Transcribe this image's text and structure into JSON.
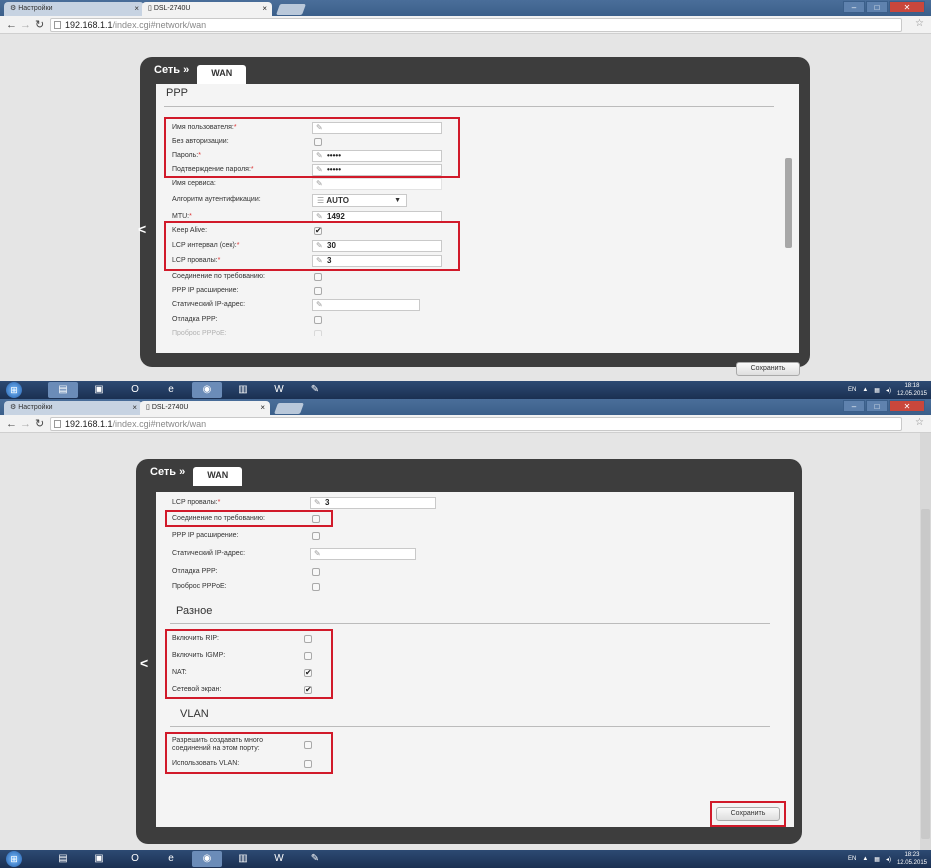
{
  "browser": {
    "tabs": [
      {
        "label": "Настройки",
        "icon": "gear-icon"
      },
      {
        "label": "DSL-2740U",
        "icon": "page-icon"
      }
    ],
    "url_host": "192.168.1.1",
    "url_path": "/index.cgi#network/wan"
  },
  "panel": {
    "breadcrumb": "Сеть »",
    "tab": "WAN",
    "save_label": "Сохранить"
  },
  "shot1": {
    "section_title": "PPP",
    "fields": {
      "username": {
        "label": "Имя пользователя:",
        "value": ""
      },
      "no_auth": {
        "label": "Без авторизации:"
      },
      "password": {
        "label": "Пароль:",
        "value": "•••••"
      },
      "password_confirm": {
        "label": "Подтверждение пароля:",
        "value": "•••••"
      },
      "service_name": {
        "label": "Имя сервиса:",
        "value": ""
      },
      "auth_algorithm": {
        "label": "Алгоритм аутентификации:",
        "value": "AUTO"
      },
      "mtu": {
        "label": "MTU:",
        "value": "1492"
      },
      "keep_alive": {
        "label": "Keep Alive:",
        "checked": true
      },
      "lcp_interval": {
        "label": "LCP интервал (сек):",
        "value": "30"
      },
      "lcp_fails": {
        "label": "LCP провалы:",
        "value": "3"
      },
      "on_demand": {
        "label": "Соединение по требованию:"
      },
      "ppp_ip_ext": {
        "label": "PPP IP расширение:"
      },
      "static_ip": {
        "label": "Статический IP-адрес:",
        "value": ""
      },
      "ppp_debug": {
        "label": "Отладка PPP:"
      },
      "pppoe_pass": {
        "label": "Проброс PPPoE:"
      }
    }
  },
  "shot2": {
    "fields": {
      "lcp_fails": {
        "label": "LCP провалы:",
        "value": "3"
      },
      "on_demand": {
        "label": "Соединение по требованию:"
      },
      "ppp_ip_ext": {
        "label": "PPP IP расширение:"
      },
      "static_ip": {
        "label": "Статический IP-адрес:",
        "value": ""
      },
      "ppp_debug": {
        "label": "Отладка PPP:"
      },
      "pppoe_pass": {
        "label": "Проброс PPPoE:"
      }
    },
    "misc_title": "Разное",
    "misc": {
      "rip": {
        "label": "Включить RIP:",
        "checked": false
      },
      "igmp": {
        "label": "Включить IGMP:",
        "checked": false
      },
      "nat": {
        "label": "NAT:",
        "checked": true
      },
      "firewall": {
        "label": "Сетевой экран:",
        "checked": true
      }
    },
    "vlan_title": "VLAN",
    "vlan": {
      "multi_conn_line1": "Разрешить создавать много",
      "multi_conn_line2": "соединений на этом порту:",
      "use_vlan": {
        "label": "Использовать VLAN:"
      }
    }
  },
  "taskbar": {
    "lang": "EN",
    "shot1_time": "18:18",
    "shot2_time": "18:23",
    "date": "12.05.2015"
  },
  "colors": {
    "highlight": "#d11a2a",
    "panel_dark": "#3d3d3d",
    "page_bg": "#e5e5e5"
  }
}
